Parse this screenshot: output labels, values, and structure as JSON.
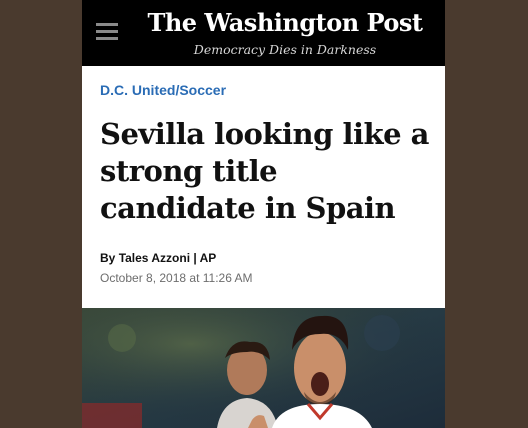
{
  "masthead": {
    "logo": "The Washington Post",
    "tagline": "Democracy Dies in Darkness"
  },
  "article": {
    "section": "D.C. United/Soccer",
    "headline": "Sevilla looking like a strong title candidate in Spain",
    "byline_prefix": "By",
    "author": "Tales Azzoni",
    "agency": "AP",
    "date": "October 8, 2018 at 11:26 AM"
  },
  "colors": {
    "kicker": "#2a6cb5",
    "masthead_bg": "#000000",
    "page_bg": "#4a3a2e"
  },
  "icons": {
    "menu": "hamburger-menu-icon"
  }
}
